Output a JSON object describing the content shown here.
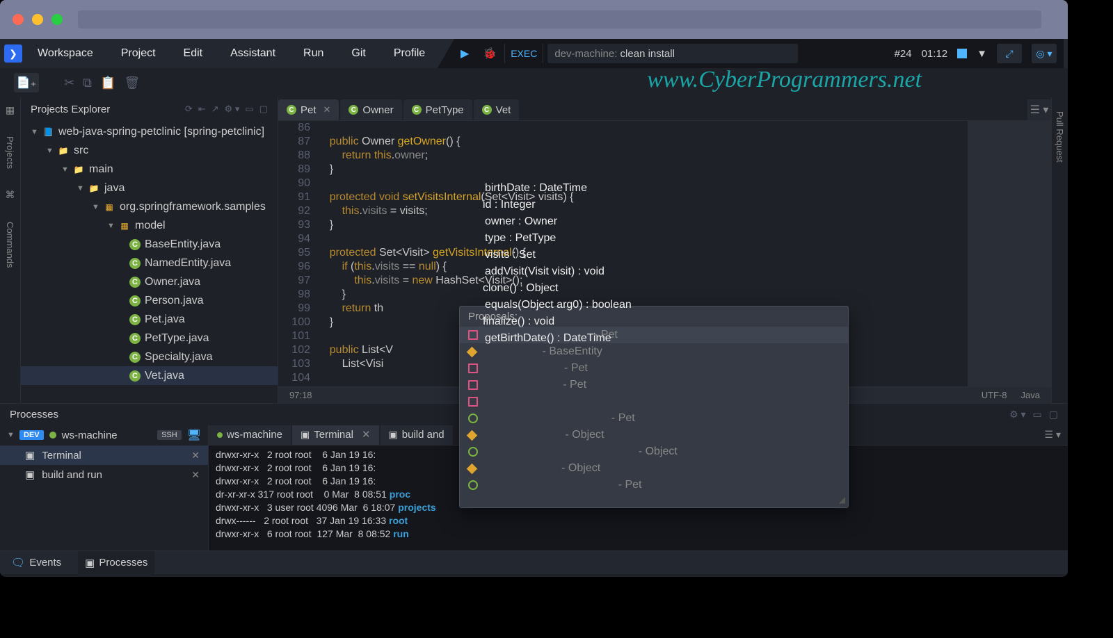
{
  "menubar": [
    "Workspace",
    "Project",
    "Edit",
    "Assistant",
    "Run",
    "Git",
    "Profile"
  ],
  "run": {
    "exec": "EXEC",
    "dev": "dev-machine:",
    "cmd": "clean install",
    "num": "#24",
    "time": "01:12"
  },
  "watermark": "www.CyberProgrammers.net",
  "explorer": {
    "title": "Projects Explorer",
    "project": "web-java-spring-petclinic [spring-petclinic]",
    "src": "src",
    "main": "main",
    "java": "java",
    "pkg": "org.springframework.samples",
    "model": "model",
    "files": [
      "BaseEntity.java",
      "NamedEntity.java",
      "Owner.java",
      "Person.java",
      "Pet.java",
      "PetType.java",
      "Specialty.java",
      "Vet.java"
    ]
  },
  "leftTabs": {
    "projects": "Projects",
    "commands": "Commands"
  },
  "rightTab": "Pull Request",
  "tabs": [
    {
      "name": "Pet",
      "active": true,
      "closable": true
    },
    {
      "name": "Owner",
      "active": false
    },
    {
      "name": "PetType",
      "active": false
    },
    {
      "name": "Vet",
      "active": false
    }
  ],
  "code": {
    "firstLine": 86,
    "lines": [
      "",
      "    public Owner getOwner() {",
      "        return this.owner;",
      "    }",
      "",
      "    protected void setVisitsInternal(Set<Visit> visits) {",
      "        this.visits = visits;",
      "    }",
      "",
      "    protected Set<Visit> getVisitsInternal() {",
      "        if (this.visits == null) {",
      "            this.visits = new HashSet<Visit>();",
      "        }",
      "        return th",
      "    }",
      "",
      "    public List<V",
      "        List<Visi                                               ernal());",
      ""
    ]
  },
  "status": {
    "pos": "97:18",
    "enc": "UTF-8",
    "lang": "Java"
  },
  "proposals": {
    "title": "Proposals:",
    "items": [
      {
        "icon": "sq-r",
        "text": "birthDate : DateTime",
        "ctx": "Pet",
        "sel": true
      },
      {
        "icon": "sq-o",
        "text": "id : Integer",
        "ctx": "BaseEntity"
      },
      {
        "icon": "sq-r",
        "text": "owner : Owner",
        "ctx": "Pet"
      },
      {
        "icon": "sq-r",
        "text": "type : PetType",
        "ctx": "Pet"
      },
      {
        "icon": "sq-r",
        "text": "visits : Set<org.springframework.samples.petclinic.model.Visi",
        "ctx": ""
      },
      {
        "icon": "cr-g",
        "text": "addVisit(Visit visit) : void",
        "ctx": "Pet"
      },
      {
        "icon": "sq-o",
        "text": "clone() : Object",
        "ctx": "Object"
      },
      {
        "icon": "cr-g",
        "text": "equals(Object arg0) : boolean",
        "ctx": "Object"
      },
      {
        "icon": "sq-o",
        "text": "finalize() : void",
        "ctx": "Object"
      },
      {
        "icon": "cr-g",
        "text": "getBirthDate() : DateTime",
        "ctx": "Pet"
      }
    ]
  },
  "processes": {
    "title": "Processes",
    "machine": "ws-machine",
    "dev": "DEV",
    "ssh": "SSH",
    "items": [
      {
        "name": "Terminal",
        "sel": true
      },
      {
        "name": "build and run"
      }
    ],
    "termTabs": [
      "ws-machine",
      "Terminal",
      "build and"
    ],
    "output": [
      "drwxr-xr-x   2 root root    6 Jan 19 16:",
      "drwxr-xr-x   2 root root    6 Jan 19 16:",
      "drwxr-xr-x   2 root root    6 Jan 19 16:",
      "dr-xr-xr-x 317 root root    0 Mar  8 08:51 proc",
      "drwxr-xr-x   3 user root 4096 Mar  6 18:07 projects",
      "drwx------   2 root root   37 Jan 19 16:33 root",
      "drwxr-xr-x   6 root root  127 Mar  8 08:52 run"
    ]
  },
  "bottom": {
    "events": "Events",
    "processes": "Processes"
  }
}
